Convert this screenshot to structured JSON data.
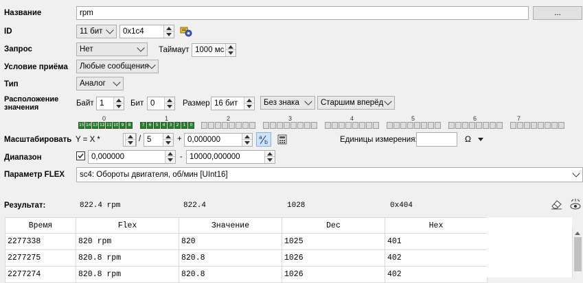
{
  "form": {
    "name_label": "Название",
    "name_value": "rpm",
    "browse_label": "...",
    "id_label": "ID",
    "id_bits": "11 бит",
    "id_value": "0x1c4",
    "request_label": "Запрос",
    "request_value": "Нет",
    "timeout_label": "Таймаут",
    "timeout_value": "1000 мс",
    "receive_label": "Условие приёма",
    "receive_value": "Любые сообщения",
    "type_label": "Тип",
    "type_value": "Аналог",
    "location_label_1": "Расположение",
    "location_label_2": "значения",
    "byte_label": "Байт",
    "byte_value": "1",
    "bit_label": "Бит",
    "bit_value": "0",
    "size_label": "Размер",
    "size_value": "16 бит",
    "sign_value": "Без знака",
    "order_value": "Старшим вперёд",
    "scale_label": "Масштабировать",
    "formula_prefix": "Y = X *",
    "numerator": "4",
    "slash": "/",
    "denominator": "5",
    "plus": "+",
    "offset": "0,000000",
    "units_label": "Единицы измерения:",
    "units_value": "",
    "omega": "Ω",
    "range_label": "Диапазон",
    "range_min": "0,000000",
    "range_dash": "-",
    "range_max": "10000,000000",
    "flex_label": "Параметр FLEX",
    "flex_value": "sc4: Обороты двигателя, об/мин [UInt16]"
  },
  "bytes": {
    "labels": [
      "0",
      "1",
      "2",
      "3",
      "4",
      "5",
      "6",
      "7"
    ],
    "bits_byte0": [
      "15",
      "14",
      "13",
      "12",
      "11",
      "10",
      "9",
      "8"
    ],
    "bits_byte1": [
      "7",
      "6",
      "5",
      "4",
      "3",
      "2",
      "1",
      "0"
    ]
  },
  "result": {
    "label": "Результат:",
    "value": "822.4 rpm",
    "raw": "822.4",
    "dec": "1028",
    "hex": "0x404"
  },
  "table": {
    "headers": [
      "Время",
      "Flex",
      "Значение",
      "Dec",
      "Hex"
    ],
    "rows": [
      [
        "2277338",
        "820 rpm",
        "820",
        "1025",
        "401"
      ],
      [
        "2277275",
        "820.8 rpm",
        "820.8",
        "1026",
        "402"
      ],
      [
        "2277274",
        "820.8 rpm",
        "820.8",
        "1026",
        "402"
      ]
    ]
  },
  "colors": {
    "bit_on": "#2e7d32",
    "bit_off": "#dcdcdc",
    "background": "#f0f0f0"
  }
}
